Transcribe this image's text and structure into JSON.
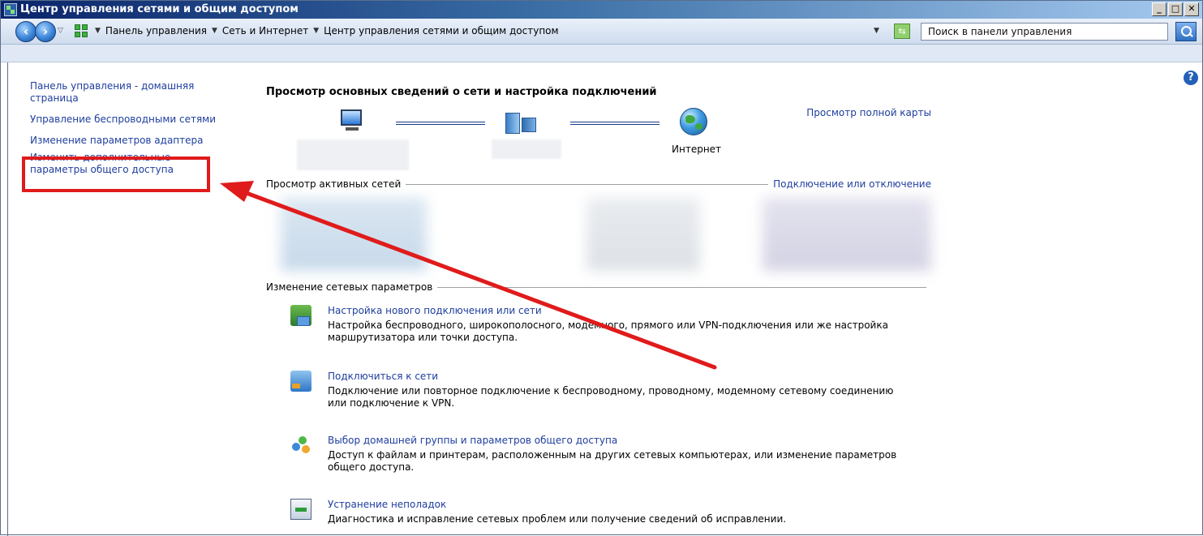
{
  "window": {
    "title": "Центр управления сетями и общим доступом",
    "controls": {
      "minimize": "_",
      "maximize": "□",
      "close": "✕"
    }
  },
  "address_bar": {
    "breadcrumbs": [
      "Панель управления",
      "Сеть и Интернет",
      "Центр управления сетями и общим доступом"
    ],
    "search_placeholder": "Поиск в панели управления"
  },
  "sidebar": {
    "items": [
      {
        "label": "Панель управления - домашняя страница"
      },
      {
        "label": "Управление беспроводными сетями"
      },
      {
        "label": "Изменение параметров адаптера"
      },
      {
        "label": "Изменить дополнительные параметры общего доступа"
      }
    ]
  },
  "main": {
    "heading": "Просмотр основных сведений о сети и настройка подключений",
    "full_map_link": "Просмотр полной карты",
    "internet_label": "Интернет",
    "active_networks_label": "Просмотр активных сетей",
    "connect_disconnect_link": "Подключение или отключение",
    "change_settings_label": "Изменение сетевых параметров",
    "tasks": [
      {
        "title": "Настройка нового подключения или сети",
        "description": "Настройка беспроводного, широкополосного, модемного, прямого или VPN-подключения или же настройка маршрутизатора или точки доступа.",
        "icon": "network-setup-icon"
      },
      {
        "title": "Подключиться к сети",
        "description": "Подключение или повторное подключение к беспроводному, проводному, модемному сетевому соединению или подключение к VPN.",
        "icon": "connect-network-icon"
      },
      {
        "title": "Выбор домашней группы и параметров общего доступа",
        "description": "Доступ к файлам и принтерам, расположенным на других сетевых компьютерах, или изменение параметров общего доступа.",
        "icon": "homegroup-icon"
      },
      {
        "title": "Устранение неполадок",
        "description": "Диагностика и исправление сетевых проблем или получение сведений об исправлении.",
        "icon": "troubleshoot-icon"
      }
    ]
  },
  "colors": {
    "link": "#1e3e9e",
    "highlight": "#e01b1b"
  }
}
